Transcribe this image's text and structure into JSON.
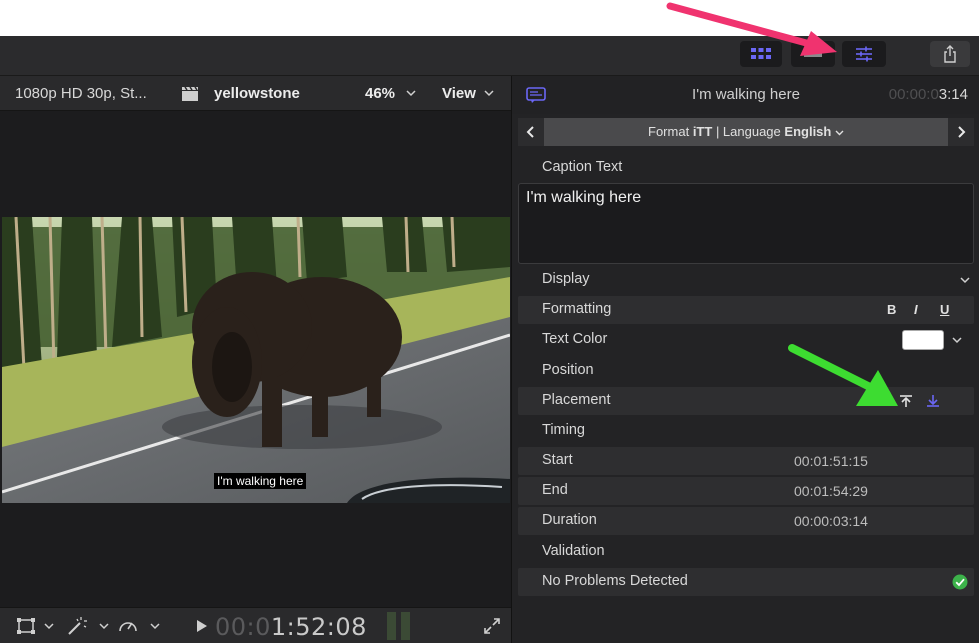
{
  "toolbar": {
    "buttons": [
      {
        "name": "browser-grid",
        "icon": "grid-icon",
        "active": true
      },
      {
        "name": "timeline",
        "icon": "timeline-icon",
        "active": false
      },
      {
        "name": "inspector",
        "icon": "sliders-icon",
        "active": true
      },
      {
        "name": "share",
        "icon": "share-icon",
        "active": false
      }
    ],
    "accent_color": "#6b67f5"
  },
  "viewer": {
    "format": "1080p HD 30p, St...",
    "project_name": "yellowstone",
    "zoom": "46%",
    "view_label": "View",
    "caption_overlay": "I'm walking here",
    "timecode_dim": "00:0",
    "timecode_bright": "1:52:08"
  },
  "inspector": {
    "title": "I'm walking here",
    "timecode_dim": "00:00:0",
    "timecode_bright": "3:14",
    "format_prefix": "Format",
    "format_value": "iTT",
    "language_prefix": "| Language",
    "language_value": "English",
    "caption_text_label": "Caption Text",
    "caption_text": "I'm walking here",
    "display_label": "Display",
    "formatting_label": "Formatting",
    "bold_label": "B",
    "italic_label": "I",
    "underline_label": "U",
    "text_color_label": "Text Color",
    "text_color_value": "#ffffff",
    "position_label": "Position",
    "placement_label": "Placement",
    "timing_label": "Timing",
    "start_label": "Start",
    "start_value": "00:01:51:15",
    "end_label": "End",
    "end_value": "00:01:54:29",
    "duration_label": "Duration",
    "duration_value": "00:00:03:14",
    "validation_label": "Validation",
    "validation_status": "No Problems Detected",
    "status_color": "#3cb24a"
  },
  "annotations": {
    "arrow_top_color": "#f0336f",
    "arrow_mid_color": "#3ddc31"
  }
}
